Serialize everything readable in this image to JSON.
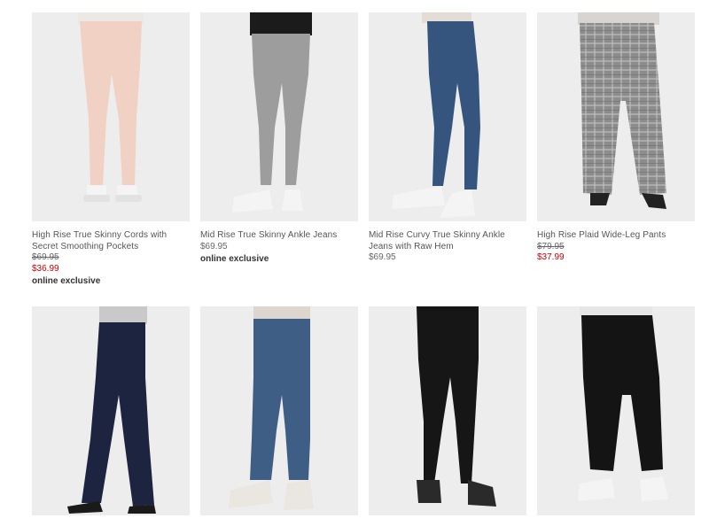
{
  "products": [
    {
      "name": "High Rise True Skinny Cords with Secret Smoothing Pockets",
      "original_price": "$69.95",
      "sale_price": "$36.99",
      "price": "",
      "badge": "online exclusive",
      "pant_color": "#f1d1c3",
      "top_color": "#ece8e3",
      "shoe_color": "#f4f4f4"
    },
    {
      "name": "Mid Rise True Skinny Ankle Jeans",
      "original_price": "",
      "sale_price": "",
      "price": "$69.95",
      "badge": "online exclusive",
      "pant_color": "#9d9d9d",
      "top_color": "#1b1b1b",
      "shoe_color": "#f4f4f4"
    },
    {
      "name": "Mid Rise Curvy True Skinny Ankle Jeans with Raw Hem",
      "original_price": "",
      "sale_price": "",
      "price": "$69.95",
      "badge": "",
      "pant_color": "#35557f",
      "top_color": "#e3ddd6",
      "shoe_color": "#f4f4f4"
    },
    {
      "name": "High Rise Plaid Wide-Leg Pants",
      "original_price": "$79.95",
      "sale_price": "$37.99",
      "price": "",
      "badge": "",
      "pant_color": "#8c8c8c",
      "top_color": "#d8d4cf",
      "shoe_color": "#222222"
    },
    {
      "name": "",
      "original_price": "",
      "sale_price": "",
      "price": "",
      "badge": "",
      "pant_color": "#1d2440",
      "top_color": "#c9c9c9",
      "shoe_color": "#1a1a1a"
    },
    {
      "name": "",
      "original_price": "",
      "sale_price": "",
      "price": "",
      "badge": "",
      "pant_color": "#3e5e86",
      "top_color": "#dcd6cf",
      "shoe_color": "#eae6e0"
    },
    {
      "name": "",
      "original_price": "",
      "sale_price": "",
      "price": "",
      "badge": "",
      "pant_color": "#161616",
      "top_color": "#161616",
      "shoe_color": "#2a2a2a"
    },
    {
      "name": "",
      "original_price": "",
      "sale_price": "",
      "price": "",
      "badge": "",
      "pant_color": "#141414",
      "top_color": "#e6e6e6",
      "shoe_color": "#f4f4f4"
    }
  ]
}
